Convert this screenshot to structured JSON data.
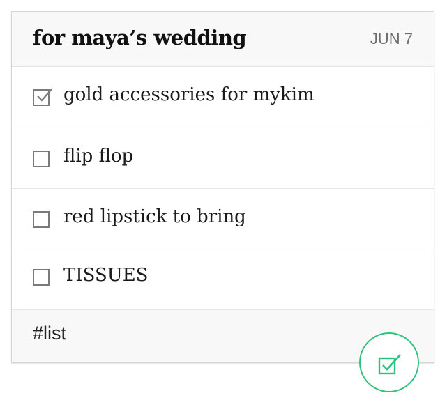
{
  "note": {
    "title": "for maya’s wedding",
    "date": "JUN 7",
    "tag": "#list"
  },
  "items": [
    {
      "text": "gold accessories for mykim",
      "checked": true
    },
    {
      "text": "flip flop",
      "checked": false
    },
    {
      "text": "red lipstick to bring",
      "checked": false
    },
    {
      "text": "TISSUES",
      "checked": false
    }
  ],
  "icons": {
    "checked_box": "checked-checkbox-icon",
    "unchecked_box": "empty-checkbox-icon",
    "fab": "checklist-icon"
  },
  "colors": {
    "accent": "#2ec27e",
    "checkbox_border": "#7a7a7a",
    "header_bg": "#f8f8f8",
    "date_text": "#6e6e6e"
  }
}
